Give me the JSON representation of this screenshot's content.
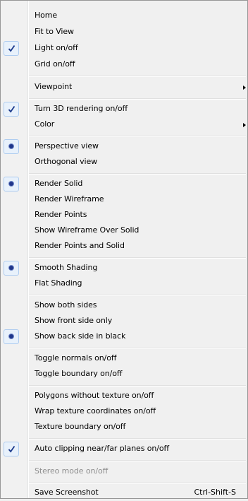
{
  "menu": {
    "items": [
      {
        "label": "Home"
      },
      {
        "label": "Fit to View"
      },
      {
        "label": "Light on/off",
        "state": "checked"
      },
      {
        "label": "Grid on/off"
      },
      {
        "label": "Viewpoint",
        "submenu": true
      },
      {
        "label": "Turn 3D rendering on/off",
        "state": "checked"
      },
      {
        "label": "Color",
        "submenu": true
      },
      {
        "label": "Perspective view",
        "state": "selected"
      },
      {
        "label": "Orthogonal view"
      },
      {
        "label": "Render Solid",
        "state": "selected"
      },
      {
        "label": "Render Wireframe"
      },
      {
        "label": "Render Points"
      },
      {
        "label": "Show Wireframe Over Solid"
      },
      {
        "label": "Render Points and Solid"
      },
      {
        "label": "Smooth Shading",
        "state": "selected"
      },
      {
        "label": "Flat Shading"
      },
      {
        "label": "Show both sides"
      },
      {
        "label": "Show front side only"
      },
      {
        "label": "Show back side in black",
        "state": "selected"
      },
      {
        "label": "Toggle normals on/off"
      },
      {
        "label": "Toggle boundary on/off"
      },
      {
        "label": "Polygons without texture on/off"
      },
      {
        "label": "Wrap texture coordinates on/off"
      },
      {
        "label": "Texture boundary on/off"
      },
      {
        "label": "Auto clipping near/far planes  on/off",
        "state": "checked"
      },
      {
        "label": "Stereo mode on/off",
        "disabled": true
      },
      {
        "label": "Save Screenshot",
        "shortcut": "Ctrl-Shift-S"
      }
    ]
  },
  "icons": {
    "checked": "checkmark-icon",
    "selected": "radio-dot-icon",
    "submenu": "submenu-arrow-icon"
  },
  "colors": {
    "menu_bg": "#f0f0f0",
    "mark_bg": "#e8f1fb",
    "mark_border": "#aeccf0",
    "check": "#1b3a8c",
    "disabled_text": "#8d8d8d"
  }
}
